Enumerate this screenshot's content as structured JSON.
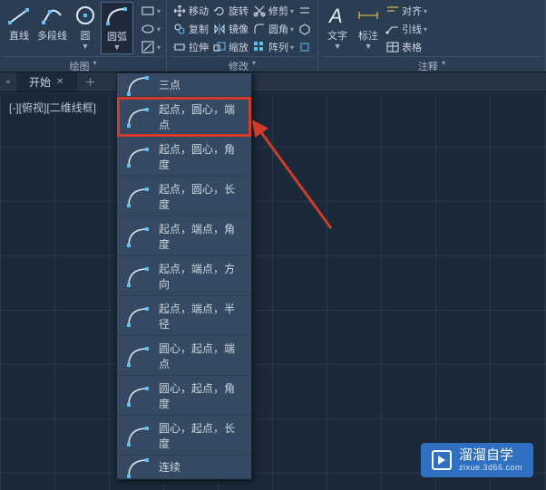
{
  "ribbon": {
    "groups": {
      "draw": {
        "label": "绘图",
        "line": "直线",
        "polyline": "多段线",
        "circle": "圆",
        "arc": "圆弧"
      },
      "draw_small": {},
      "modify": {
        "label": "修改",
        "move": "移动",
        "copy": "复制",
        "stretch": "拉伸",
        "rotate": "旋转",
        "mirror": "镜像",
        "scale": "缩放",
        "trim": "修剪",
        "fillet": "圆角",
        "array": "阵列"
      },
      "annotate": {
        "label": "注释",
        "text": "文字",
        "dimension": "标注",
        "align": "对齐",
        "leader": "引线",
        "table": "表格"
      }
    }
  },
  "tabstrip": {
    "start": "开始"
  },
  "viewport": {
    "view_label": "[-][俯视][二维线框]"
  },
  "arc_menu": {
    "items": [
      {
        "label": "三点",
        "small": true
      },
      {
        "label": "起点，圆心，端点",
        "selected": true
      },
      {
        "label": "起点，圆心，角度"
      },
      {
        "label": "起点，圆心，长度"
      },
      {
        "label": "起点，端点，角度"
      },
      {
        "label": "起点，端点，方向"
      },
      {
        "label": "起点，端点，半径"
      },
      {
        "label": "圆心，起点，端点"
      },
      {
        "label": "圆心，起点，角度"
      },
      {
        "label": "圆心，起点，长度"
      },
      {
        "label": "连续",
        "small": true
      }
    ]
  },
  "watermark": {
    "title": "溜溜自学",
    "url": "zixue.3d66.com"
  }
}
